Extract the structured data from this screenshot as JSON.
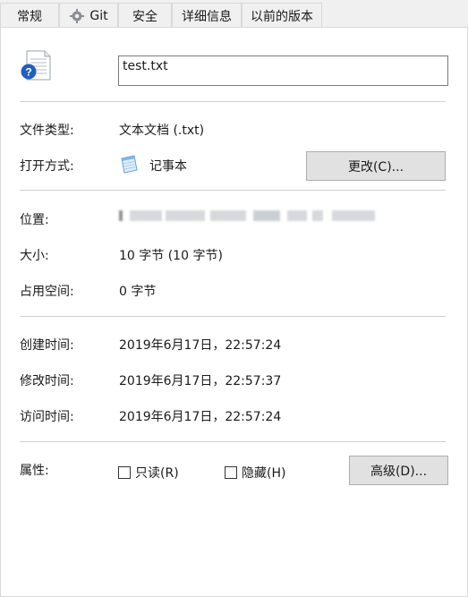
{
  "tabs": [
    {
      "label": "常规",
      "active": true
    },
    {
      "label": "Git",
      "active": false,
      "icon": "git-gear-icon"
    },
    {
      "label": "安全",
      "active": false
    },
    {
      "label": "详细信息",
      "active": false
    },
    {
      "label": "以前的版本",
      "active": false
    }
  ],
  "file": {
    "name": "test.txt",
    "icon": "text-document-help-icon"
  },
  "props": {
    "type_label": "文件类型:",
    "type_value": "文本文档 (.txt)",
    "open_with_label": "打开方式:",
    "open_with_value": "记事本",
    "open_with_icon": "notepad-icon",
    "change_button": "更改(C)...",
    "location_label": "位置:",
    "size_label": "大小:",
    "size_value": "10 字节 (10 字节)",
    "size_on_disk_label": "占用空间:",
    "size_on_disk_value": "0 字节",
    "created_label": "创建时间:",
    "created_value": "2019年6月17日，22:57:24",
    "modified_label": "修改时间:",
    "modified_value": "2019年6月17日，22:57:37",
    "accessed_label": "访问时间:",
    "accessed_value": "2019年6月17日，22:57:24",
    "attributes_label": "属性:",
    "readonly_label": "只读(R)",
    "readonly_checked": false,
    "hidden_label": "隐藏(H)",
    "hidden_checked": false,
    "advanced_button": "高级(D)..."
  }
}
